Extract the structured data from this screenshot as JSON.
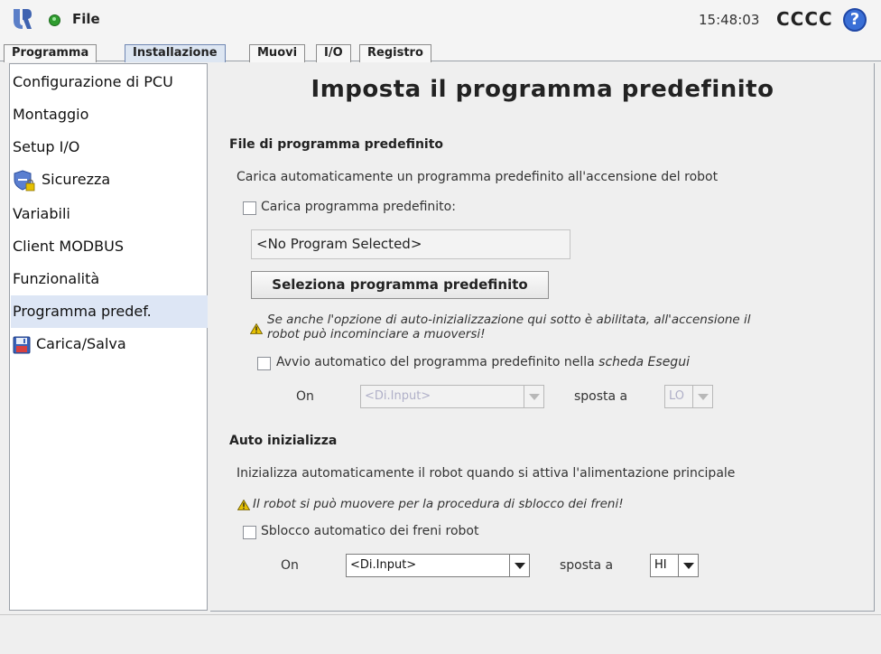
{
  "header": {
    "menu_label": "File",
    "time": "15:48:03",
    "robot_name": "CCCC",
    "help_glyph": "?",
    "status_color": "#2f9c2f"
  },
  "tabs": [
    {
      "label": "Programma"
    },
    {
      "label": "Installazione"
    },
    {
      "label": "Muovi"
    },
    {
      "label": "I/O"
    },
    {
      "label": "Registro"
    }
  ],
  "active_tab": "Installazione",
  "sidebar": {
    "items": [
      {
        "label": "Configurazione di PCU"
      },
      {
        "label": "Montaggio"
      },
      {
        "label": "Setup I/O"
      },
      {
        "label": "Sicurezza",
        "icon": "shield-lock-icon"
      },
      {
        "label": "Variabili"
      },
      {
        "label": "Client MODBUS"
      },
      {
        "label": "Funzionalità"
      },
      {
        "label": "Programma predef."
      },
      {
        "label": "Carica/Salva",
        "icon": "floppy-disk-icon"
      }
    ],
    "active_item": "Programma predef."
  },
  "main": {
    "title": "Imposta il programma predefinito",
    "default_program": {
      "section_title": "File di programma predefinito",
      "description": "Carica automaticamente un programma predefinito all'accensione del robot",
      "load_checkbox_label": "Carica programma predefinito:",
      "load_checked": false,
      "selected_program": "<No Program Selected>",
      "select_button": "Seleziona programma predefinito",
      "warning_line1": "Se anche l'opzione di auto-inizializzazione qui sotto è abilitata, all'accensione il",
      "warning_line2": "robot può incominciare a muoversi!",
      "autostart_label": "Avvio automatico del programma predefinito nella",
      "autostart_label_em": "scheda Esegui",
      "autostart_checked": false,
      "on_label": "On",
      "input_value": "<Di.Input>",
      "moves_to_label": "sposta a",
      "level_value": "LO"
    },
    "auto_init": {
      "section_title": "Auto inizializza",
      "description": "Inizializza automaticamente il robot quando si attiva l'alimentazione principale",
      "warning": "Il robot si può muovere per la procedura di sblocco dei freni!",
      "brake_checkbox_label": "Sblocco automatico dei freni robot",
      "brake_checked": false,
      "on_label": "On",
      "input_value": "<Di.Input>",
      "moves_to_label": "sposta a",
      "level_value": "HI"
    }
  },
  "colors": {
    "accent": "#3a6fd6",
    "active_tab_bg": "#dde6f2",
    "warning": "#e6c000"
  }
}
